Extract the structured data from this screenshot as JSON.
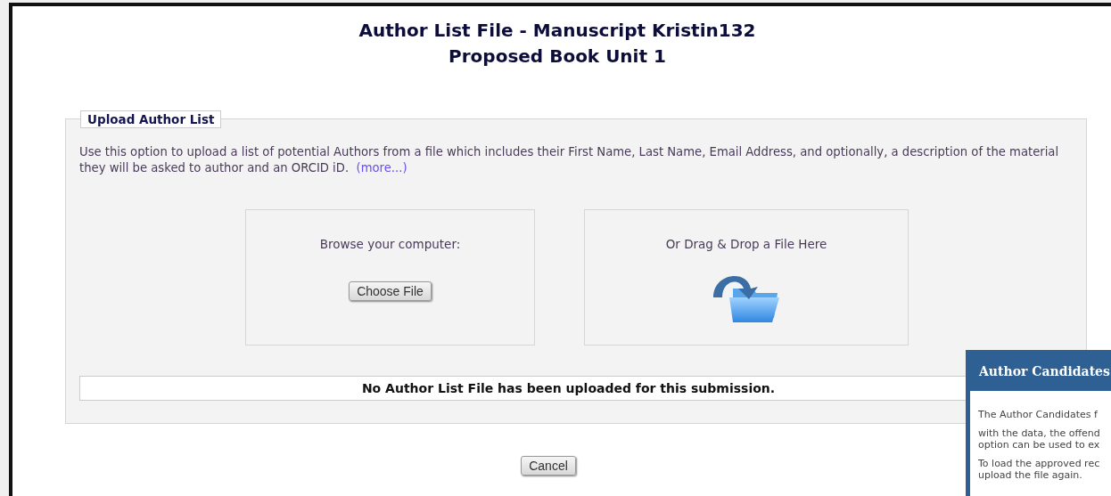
{
  "title": [
    "Author List File - Manuscript Kristin132",
    "Proposed Book Unit 1"
  ],
  "upload_panel": {
    "legend": "Upload Author List",
    "description": "Use this option to upload a list of potential Authors from a file which includes their First Name, Last Name, Email Address, and optionally, a description of the material they will be asked to author and an ORCID iD.",
    "more_link": "(more...)",
    "browse": {
      "label": "Browse your computer:",
      "button": "Choose File"
    },
    "drop": {
      "label": "Or Drag & Drop a File Here"
    },
    "status": "No Author List File has been uploaded for this submission."
  },
  "cancel_button": "Cancel",
  "popup": {
    "title": "Author Candidates",
    "paragraphs": [
      [
        "The Author Candidates f"
      ],
      [
        "with the data, the offend",
        "option can be used to ex"
      ],
      [
        "To load the approved rec",
        "upload the file again."
      ]
    ]
  }
}
